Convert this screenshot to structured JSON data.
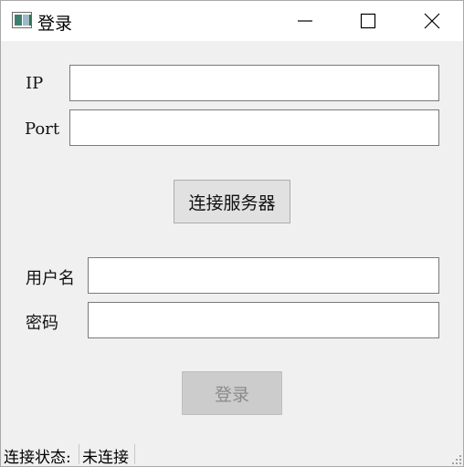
{
  "window": {
    "title": "登录",
    "icons": {
      "app": "app-window-icon",
      "minimize": "minimize-icon",
      "maximize": "maximize-icon",
      "close": "close-icon"
    }
  },
  "server": {
    "ip_label": "IP",
    "ip_value": "",
    "port_label": "Port",
    "port_value": "",
    "connect_button": "连接服务器"
  },
  "account": {
    "username_label": "用户名",
    "username_value": "",
    "password_label": "密码",
    "password_value": "",
    "login_button": "登录",
    "login_enabled": false
  },
  "status": {
    "label": "连接状态:",
    "value": "未连接"
  },
  "colors": {
    "background": "#f0f0f0",
    "titlebar": "#ffffff",
    "button": "#e1e1e1",
    "button_disabled": "#cccccc",
    "disabled_text": "#8a8a8a"
  }
}
